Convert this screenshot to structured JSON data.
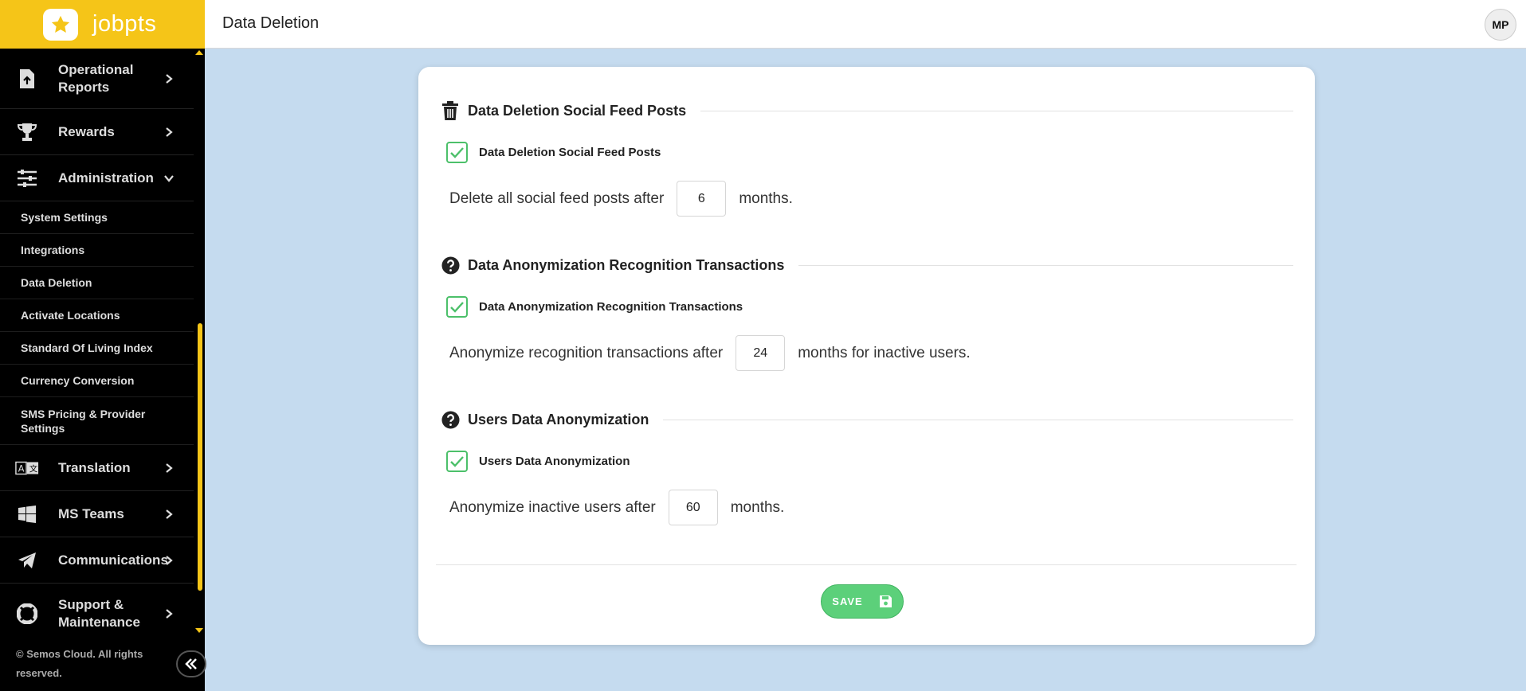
{
  "app": {
    "name": "jobpts"
  },
  "header": {
    "title": "Data Deletion",
    "avatar_initials": "MP"
  },
  "sidebar": {
    "top_items": [
      {
        "label": "Operational Reports",
        "icon": "report-upload-icon"
      },
      {
        "label": "Rewards",
        "icon": "trophy-icon"
      },
      {
        "label": "Administration",
        "icon": "sliders-icon"
      }
    ],
    "admin_subitems": [
      "System Settings",
      "Integrations",
      "Data Deletion",
      "Activate Locations",
      "Standard Of Living Index",
      "Currency Conversion",
      "SMS Pricing & Provider Settings"
    ],
    "bottom_items": [
      {
        "label": "Translation",
        "icon": "translate-icon"
      },
      {
        "label": "MS Teams",
        "icon": "windows-icon"
      },
      {
        "label": "Communications",
        "icon": "paper-plane-icon"
      },
      {
        "label": "Support & Maintenance",
        "icon": "lifebuoy-icon"
      }
    ],
    "footer": "© Semos Cloud. All rights reserved."
  },
  "sections": [
    {
      "title": "Data Deletion Social Feed Posts",
      "icon": "trash-icon",
      "checkbox_label": "Data Deletion Social Feed Posts",
      "checked": true,
      "text_before": "Delete all social feed posts after",
      "value": "6",
      "text_after": "months."
    },
    {
      "title": "Data Anonymization Recognition Transactions",
      "icon": "question-circle-icon",
      "checkbox_label": "Data Anonymization Recognition Transactions",
      "checked": true,
      "text_before": "Anonymize recognition transactions after",
      "value": "24",
      "text_after": "months for inactive users."
    },
    {
      "title": "Users Data Anonymization",
      "icon": "question-circle-icon",
      "checkbox_label": "Users Data Anonymization",
      "checked": true,
      "text_before": "Anonymize inactive users after",
      "value": "60",
      "text_after": "months."
    }
  ],
  "actions": {
    "save_label": "SAVE"
  },
  "colors": {
    "brand": "#f5c518",
    "accent_green": "#5cd07a",
    "background": "#c5dbef"
  }
}
